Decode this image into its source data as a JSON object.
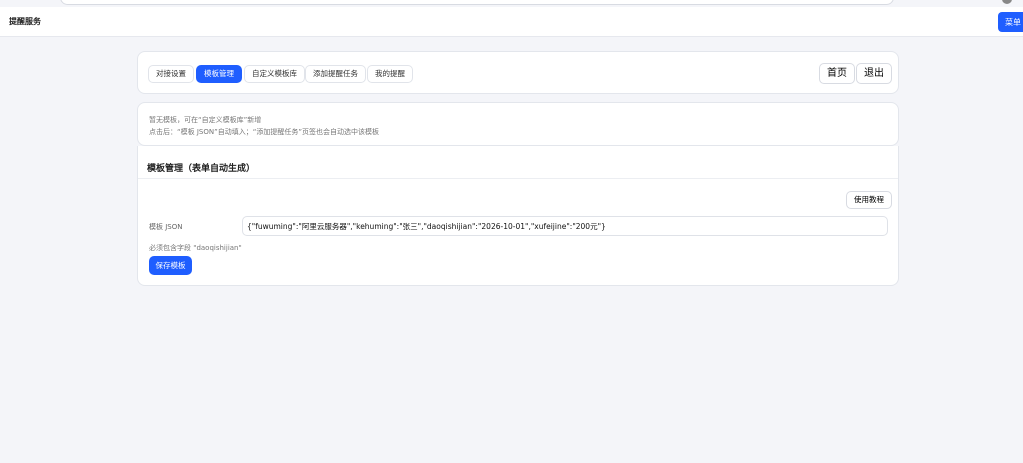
{
  "header": {
    "title": "提醒服务",
    "menu_label": "菜单"
  },
  "nav": {
    "tabs": [
      {
        "label": "对接设置"
      },
      {
        "label": "模板管理",
        "active": true
      },
      {
        "label": "自定义模板库"
      },
      {
        "label": "添加提醒任务"
      },
      {
        "label": "我的提醒"
      }
    ],
    "home_label": "首页",
    "logout_label": "退出"
  },
  "notice": {
    "line1": "暂无模板，可在“自定义模板库”新增",
    "line2": "点击后：“模板 JSON”自动填入；“添加提醒任务”页签也会自动选中该模板"
  },
  "form": {
    "title": "模板管理（表单自动生成）",
    "help_label": "使用教程",
    "json_label": "模板 JSON",
    "json_value": "{\"fuwuming\":\"阿里云服务器\",\"kehuming\":\"张三\",\"daoqishijian\":\"2026-10-01\",\"xufeijine\":\"200元\"}",
    "hint": "必须包含字段 \"daoqishijian\"",
    "save_label": "保存模板"
  },
  "colors": {
    "accent": "#1f5eff",
    "background": "#f4f5f9"
  }
}
